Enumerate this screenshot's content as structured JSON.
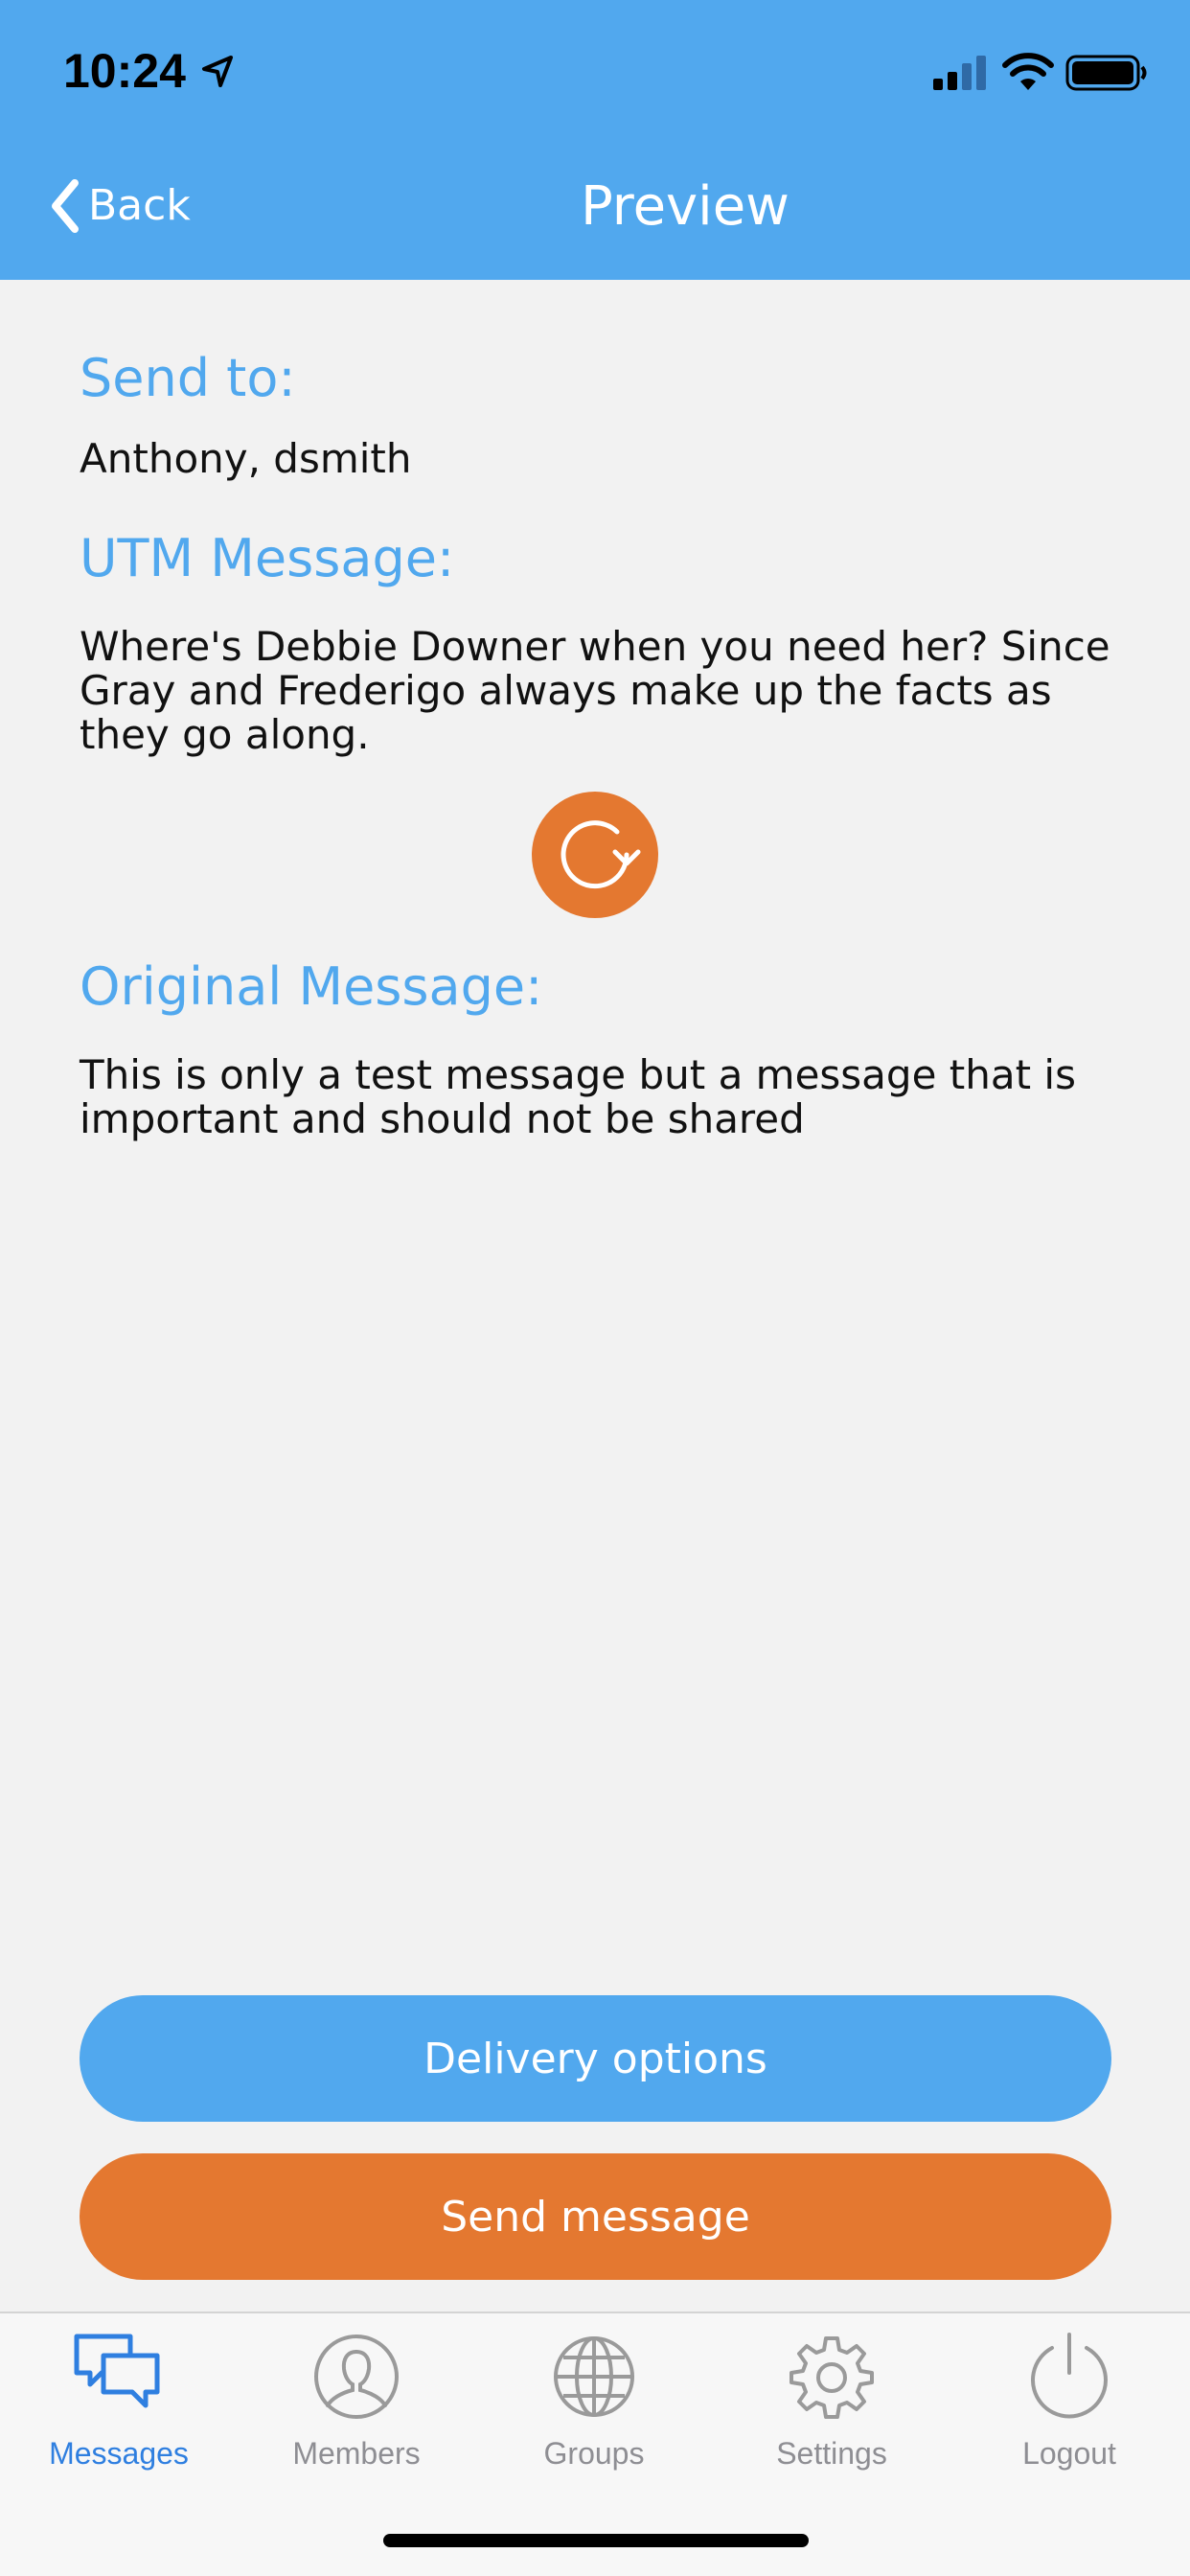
{
  "status_bar": {
    "time": "10:24"
  },
  "nav": {
    "back_label": "Back",
    "title": "Preview"
  },
  "send_to": {
    "heading": "Send to:",
    "value": "Anthony, dsmith"
  },
  "utm_message": {
    "heading": "UTM Message:",
    "text": "Where's Debbie Downer when you need her? Since Gray and Frederigo always make up the facts as they go along."
  },
  "original_message": {
    "heading": "Original Message:",
    "text": "This is only a test message but a message that is important and should not be shared"
  },
  "actions": {
    "delivery_label": "Delivery options",
    "send_label": "Send message"
  },
  "tabs": [
    {
      "label": "Messages",
      "icon": "chat-bubbles-icon",
      "active": true
    },
    {
      "label": "Members",
      "icon": "user-icon",
      "active": false
    },
    {
      "label": "Groups",
      "icon": "globe-icon",
      "active": false
    },
    {
      "label": "Settings",
      "icon": "gear-icon",
      "active": false
    },
    {
      "label": "Logout",
      "icon": "power-icon",
      "active": false
    }
  ],
  "colors": {
    "header": "#51a8ee",
    "accent_blue": "#51a8ee",
    "accent_orange": "#e47830",
    "active_tab": "#2f7fe0",
    "inactive_tab": "#8e8e93",
    "background": "#f2f2f2"
  }
}
